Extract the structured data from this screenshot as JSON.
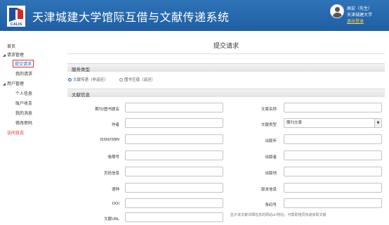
{
  "header": {
    "site_title": "天津城建大学馆际互借与文献传递系统",
    "logo_text": "CALIS",
    "user": {
      "name": "高宏（先生）",
      "org": "天津城建大学",
      "logout": "退出登录"
    }
  },
  "sidebar": {
    "home": "首页",
    "request_group": "请求管理",
    "submit_request": "提交请求",
    "my_requests": "我的请求",
    "user_group": "用户管理",
    "personal_info": "个人信息",
    "account": "账户收支",
    "messages": "我的消息",
    "change_password": "修改密码",
    "visit_log": "访问日志"
  },
  "main": {
    "page_title": "提交请求",
    "service_section": "服务类型",
    "service_options": [
      {
        "label": "文献传递（非返还）",
        "checked": true
      },
      {
        "label": "图书互借（返还）",
        "checked": false
      }
    ],
    "doc_section": "文献信息",
    "fields_left": [
      {
        "label": "期刊/图书题名",
        "value": ""
      },
      {
        "label": "作者",
        "value": ""
      },
      {
        "label": "ISSN/ISBN",
        "value": ""
      },
      {
        "label": "卷期号",
        "value": ""
      },
      {
        "label": "页码信息",
        "value": ""
      },
      {
        "label": "语种",
        "value": ""
      },
      {
        "label": "DOI",
        "value": ""
      },
      {
        "label": "文献URL",
        "value": ""
      }
    ],
    "fields_right": [
      {
        "label": "文章名称",
        "value": ""
      },
      {
        "label": "文献类型",
        "value": "期刊文章"
      },
      {
        "label": "出版年",
        "value": ""
      },
      {
        "label": "出版者",
        "value": ""
      },
      {
        "label": "出版地",
        "value": ""
      },
      {
        "label": "版本信息",
        "value": ""
      },
      {
        "label": "条码号",
        "value": ""
      }
    ],
    "url_hint": "显示该文献详细信息的网站url地址，可帮助馆员快速获取文献"
  }
}
